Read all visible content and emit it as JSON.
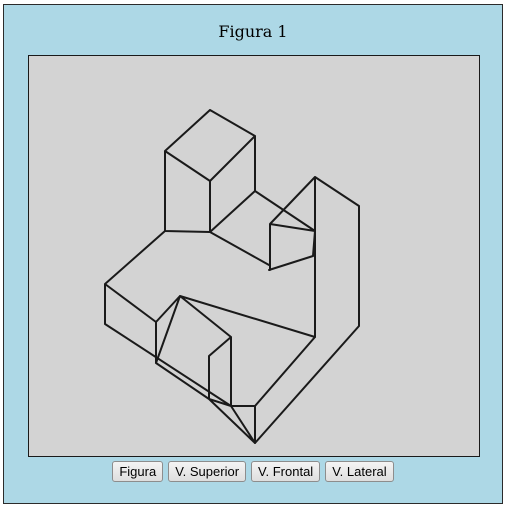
{
  "panel": {
    "title": "Figura 1"
  },
  "figure": {
    "stroke_color": "#1a1a1a",
    "background": "#d3d3d3"
  },
  "buttons": [
    {
      "label": "Figura"
    },
    {
      "label": "V. Superior"
    },
    {
      "label": "V. Frontal"
    },
    {
      "label": "V. Lateral"
    }
  ],
  "colors": {
    "panel_bg": "#add8e6",
    "canvas_bg": "#d3d3d3"
  }
}
